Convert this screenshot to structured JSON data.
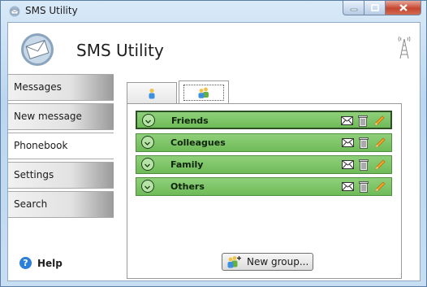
{
  "window": {
    "title": "SMS Utility"
  },
  "header": {
    "title": "SMS Utility"
  },
  "nav": {
    "items": [
      {
        "label": "Messages"
      },
      {
        "label": "New message"
      },
      {
        "label": "Phonebook"
      },
      {
        "label": "Settings"
      },
      {
        "label": "Search"
      }
    ],
    "active_index": 2,
    "help_label": "Help"
  },
  "tabs": [
    {
      "icon": "single-contact-icon"
    },
    {
      "icon": "contact-group-icon"
    }
  ],
  "selected_tab": 1,
  "groups": [
    {
      "name": "Friends",
      "selected": true
    },
    {
      "name": "Colleagues",
      "selected": false
    },
    {
      "name": "Family",
      "selected": false
    },
    {
      "name": "Others",
      "selected": false
    }
  ],
  "new_group_button": {
    "label": "New group..."
  },
  "colors": {
    "group_fill": "#78c262",
    "group_border": "#4f8f3e",
    "accent": "#2b7fd8"
  }
}
